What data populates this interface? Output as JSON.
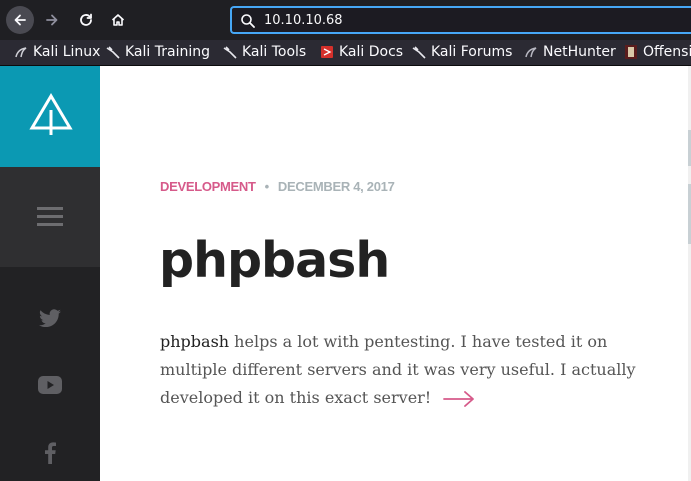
{
  "browser": {
    "url": "10.10.10.68",
    "bookmarks": [
      {
        "label": "Kali Linux",
        "icon": "kali-icon"
      },
      {
        "label": "Kali Training",
        "icon": "kali-dragon-icon"
      },
      {
        "label": "Kali Tools",
        "icon": "kali-dragon-icon"
      },
      {
        "label": "Kali Docs",
        "icon": "kali-docs-icon"
      },
      {
        "label": "Kali Forums",
        "icon": "kali-dragon-icon"
      },
      {
        "label": "NetHunter",
        "icon": "nethunter-icon"
      },
      {
        "label": "Offensi",
        "icon": "offsec-icon"
      }
    ]
  },
  "sidebar": {
    "accent": "#0b99b3",
    "social": [
      "twitter-icon",
      "youtube-icon",
      "facebook-icon"
    ]
  },
  "post": {
    "category": "DEVELOPMENT",
    "separator": "•",
    "date": "DECEMBER 4, 2017",
    "title": "phpbash",
    "excerpt_strong": "phpbash",
    "excerpt_rest": " helps a lot with pentesting. I have tested it on multiple different servers and it was very useful. I actually developed it on this exact server!",
    "accent": "#d65a8a"
  }
}
